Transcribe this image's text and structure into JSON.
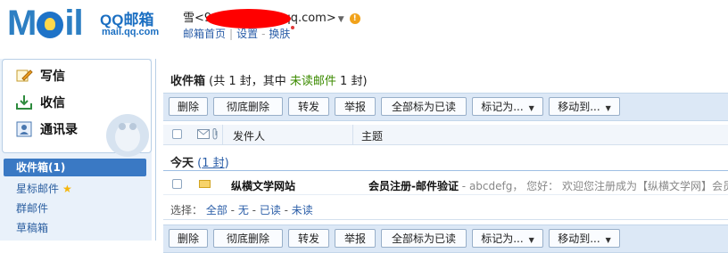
{
  "header": {
    "logo_text": "Mail",
    "brand_name": "QQ邮箱",
    "brand_domain": "mail.qq.com",
    "user_prefix": "雪<9",
    "user_suffix": "1@qq.com>",
    "links": [
      "邮箱首页",
      "设置",
      "换肤"
    ]
  },
  "sidebar": {
    "actions": [
      {
        "label": "写信",
        "icon": "pencil-icon"
      },
      {
        "label": "收信",
        "icon": "inbox-download-icon"
      },
      {
        "label": "通讯录",
        "icon": "contacts-icon"
      }
    ],
    "folders": [
      {
        "label": "收件箱(1)",
        "active": true
      },
      {
        "label": "星标邮件",
        "star": true
      },
      {
        "label": "群邮件"
      },
      {
        "label": "草稿箱"
      }
    ]
  },
  "main": {
    "title_folder": "收件箱",
    "title_count": " (共 1 封，其中 ",
    "title_unread_label": "未读邮件",
    "title_unread_count": " 1 封)",
    "toolbar": {
      "delete": "删除",
      "delete_permanent": "彻底删除",
      "forward": "转发",
      "report": "举报",
      "mark_all_read": "全部标为已读",
      "mark_as": "标记为...",
      "move_to": "移动到..."
    },
    "columns": {
      "sender": "发件人",
      "subject": "主题"
    },
    "group": {
      "label": "今天",
      "count": "1 封"
    },
    "mails": [
      {
        "sender": "纵横文学网站",
        "subject": "会员注册-邮件验证",
        "preview": " - abcdefg， 您好： 欢迎您注册成为【纵横文学网】会员"
      }
    ],
    "select": {
      "label": "选择：",
      "options": [
        "全部",
        "无",
        "已读",
        "未读"
      ]
    }
  },
  "colors": {
    "accent": "#3a79c4",
    "toolbar_bg": "#dce8f6",
    "unread": "#3c8b00",
    "redaction": "#ff0000"
  }
}
